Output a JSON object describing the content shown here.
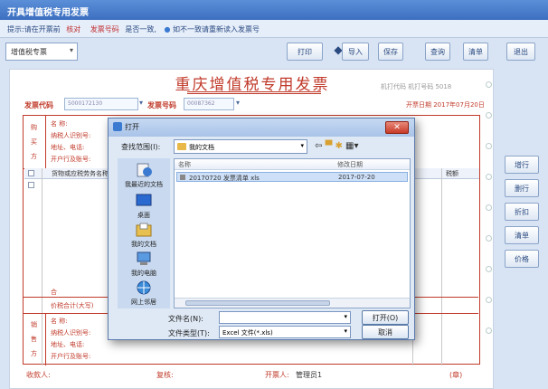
{
  "window": {
    "title": "开具增值税专用发票"
  },
  "notice": {
    "text1": "提示:请在开票前",
    "text2": "核对",
    "text3": "发票号码",
    "text4": "是否一致,",
    "text5": "如不一致请重新读入发票号"
  },
  "toolbar": {
    "type_select": "增值税专票",
    "buttons": [
      "打印",
      "导入",
      "保存",
      "查询",
      "清单",
      "退出"
    ]
  },
  "invoice": {
    "title": "重庆增值税专用发票",
    "meta_right": "机打代码 机打号码 5018",
    "code_label": "发票代码",
    "code_value": "5000172130",
    "number_label": "发票号码",
    "number_value": "00087362",
    "date_value": "开票日期 2017年07月20日",
    "buyer_side_label": [
      "购",
      "买",
      "方"
    ],
    "buyer_fields": [
      "名    称:",
      "纳税人识别号:",
      "地址、电话:",
      "开户行及账号:"
    ],
    "table_header": "货物或应税劳务名称",
    "table_header_right": "税额",
    "sum_label": "合",
    "total_label": "价税合计(大写)",
    "seller_side_label": [
      "销",
      "售",
      "方"
    ],
    "seller_fields": [
      "名    称:",
      "纳税人识别号:",
      "地址、电话:",
      "开户行及账号:"
    ]
  },
  "footer": {
    "payee": "收款人:",
    "reviewer": "复核:",
    "drawer": "开票人:",
    "drawer_name": "管理员1",
    "seller_stamp": "(章)"
  },
  "side_buttons": [
    "增行",
    "删行",
    "折扣",
    "清单",
    "价格"
  ],
  "dialog": {
    "title": "打开",
    "close_label": "✕",
    "lookin_label": "查找范围(I):",
    "lookin_value": "我的文档",
    "places": [
      "我最近的文档",
      "桌面",
      "我的文档",
      "我的电脑",
      "网上邻居"
    ],
    "col_name": "名称",
    "col_date": "修改日期",
    "file_name": "20170720 发票清单 xls",
    "file_date": "2017-07-20",
    "filename_label": "文件名(N):",
    "filename_value": "",
    "filetype_label": "文件类型(T):",
    "filetype_value": "Excel 文件(*.xls)",
    "open_button": "打开(O)",
    "cancel_button": "取消"
  }
}
